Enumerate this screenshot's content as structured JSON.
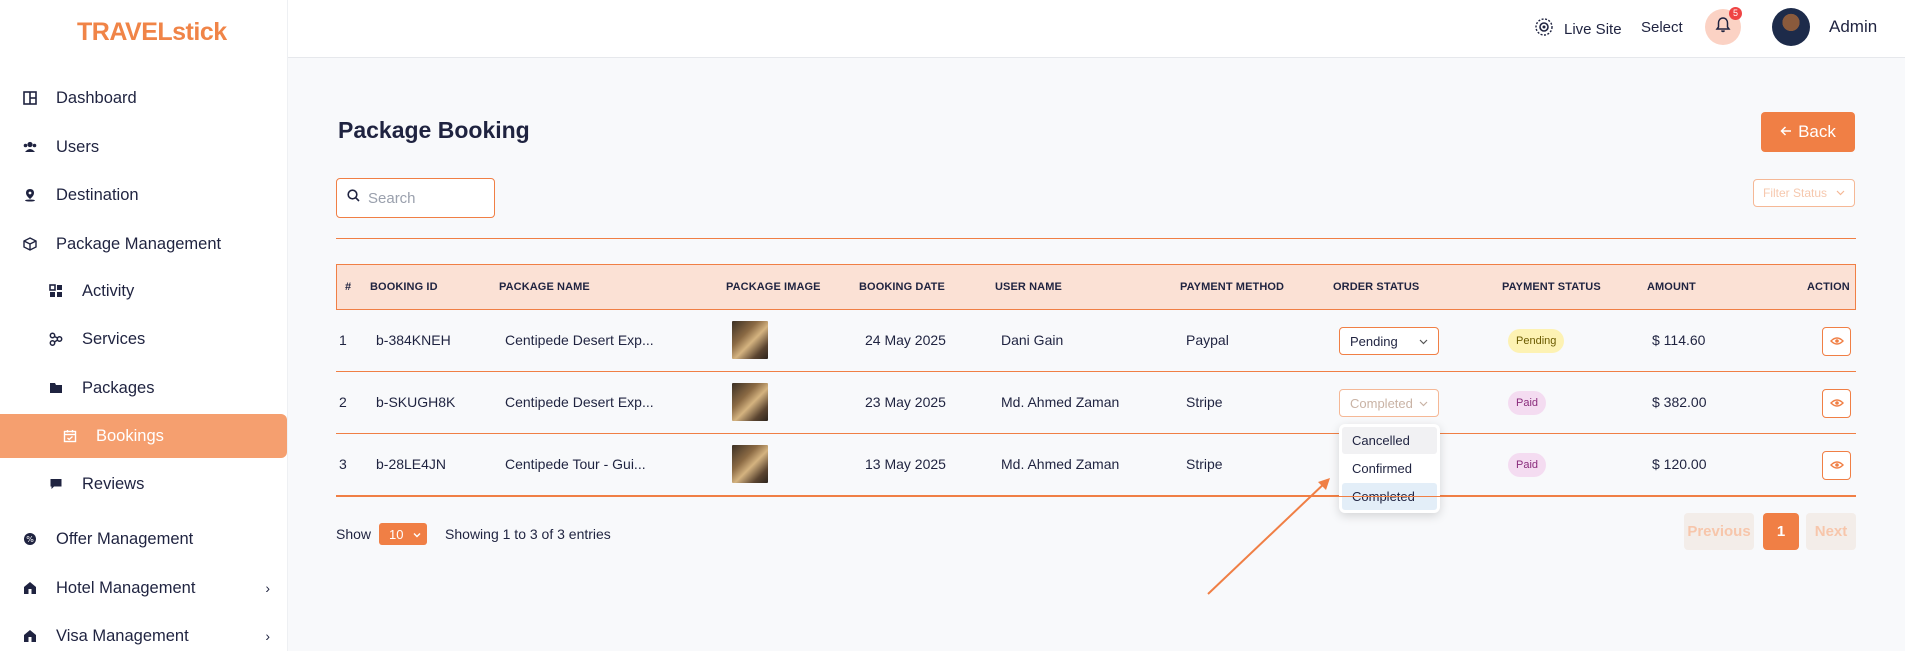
{
  "brand": {
    "logo_prefix": "TRAVEL",
    "logo_suffix": "stick",
    "color": "#f08447"
  },
  "sidebar": {
    "items": [
      {
        "label": "Dashboard",
        "icon": "dashboard-icon"
      },
      {
        "label": "Users",
        "icon": "users-icon"
      },
      {
        "label": "Destination",
        "icon": "map-pin-icon"
      },
      {
        "label": "Package Management",
        "icon": "box-icon"
      },
      {
        "label": "Activity",
        "icon": "grid-icon"
      },
      {
        "label": "Services",
        "icon": "services-icon"
      },
      {
        "label": "Packages",
        "icon": "folder-icon"
      },
      {
        "label": "Bookings",
        "icon": "calendar-icon",
        "active": true
      },
      {
        "label": "Reviews",
        "icon": "comment-icon"
      },
      {
        "label": "Offer Management",
        "icon": "offer-icon"
      },
      {
        "label": "Hotel Management",
        "icon": "hotel-icon"
      },
      {
        "label": "Visa Management",
        "icon": "visa-icon"
      }
    ]
  },
  "header": {
    "live_site": "Live Site",
    "select": "Select",
    "notifications_count": "5",
    "user_name": "Admin"
  },
  "page": {
    "title": "Package Booking",
    "back_label": "Back",
    "search_placeholder": "Search",
    "filter_placeholder": "Filter Status"
  },
  "table": {
    "columns": [
      "#",
      "BOOKING ID",
      "PACKAGE NAME",
      "PACKAGE IMAGE",
      "BOOKING DATE",
      "USER NAME",
      "PAYMENT METHOD",
      "ORDER STATUS",
      "PAYMENT STATUS",
      "AMOUNT",
      "ACTION"
    ],
    "rows": [
      {
        "num": "1",
        "booking_id": "b-384KNEH",
        "package_name": "Centipede Desert Exp...",
        "booking_date": "24 May 2025",
        "user_name": "Dani Gain",
        "payment_method": "Paypal",
        "order_status": "Pending",
        "payment_status": "Pending",
        "amount": "$ 114.60"
      },
      {
        "num": "2",
        "booking_id": "b-SKUGH8K",
        "package_name": "Centipede Desert Exp...",
        "booking_date": "23 May 2025",
        "user_name": "Md. Ahmed Zaman",
        "payment_method": "Stripe",
        "order_status": "Completed",
        "payment_status": "Paid",
        "amount": "$ 382.00"
      },
      {
        "num": "3",
        "booking_id": "b-28LE4JN",
        "package_name": "Centipede Tour - Gui...",
        "booking_date": "13 May 2025",
        "user_name": "Md. Ahmed Zaman",
        "payment_method": "Stripe",
        "order_status": "",
        "payment_status": "Paid",
        "amount": "$ 120.00"
      }
    ]
  },
  "dropdown": {
    "options": [
      "Cancelled",
      "Confirmed",
      "Completed"
    ],
    "selected": "Completed"
  },
  "footer": {
    "show_label": "Show",
    "page_length": "10",
    "info": "Showing 1 to 3 of 3 entries",
    "prev": "Previous",
    "current_page": "1",
    "next": "Next"
  },
  "colors": {
    "accent": "#f07f45",
    "table_header_bg": "#fbe1d5",
    "active_nav": "#f59f6f"
  }
}
